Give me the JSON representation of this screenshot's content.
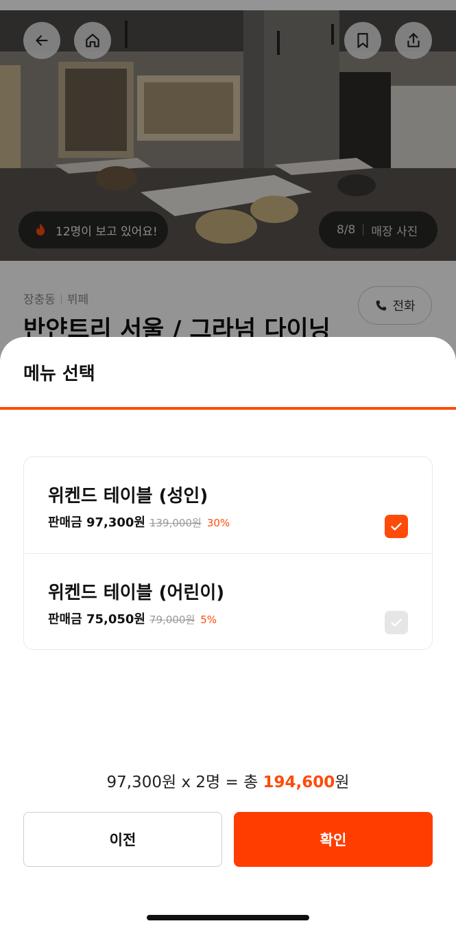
{
  "hero": {
    "viewers_text": "12명이 보고 있어요!",
    "photo_counter": "8/8",
    "photo_label": "매장 사진",
    "icons": [
      "back-arrow-icon",
      "home-icon",
      "bookmark-icon",
      "share-icon",
      "flame-icon"
    ]
  },
  "info": {
    "area": "장충동",
    "category": "뷔페",
    "title": "반얀트리 서울 / 그라넘 다이닝",
    "call_label": "전화"
  },
  "sheet": {
    "title": "메뉴 선택",
    "accent_color": "#ff4b0a",
    "menus": [
      {
        "name": "위켄드 테이블 (성인)",
        "price": "판매금 97,300원",
        "original": "139,000원",
        "discount": "30%",
        "checked": true
      },
      {
        "name": "위켄드 테이블 (어린이)",
        "price": "판매금 75,050원",
        "original": "79,000원",
        "discount": "5%",
        "checked": false
      }
    ],
    "total_prefix": "97,300원 x 2명 = 총 ",
    "total_amount": "194,600",
    "total_suffix": "원",
    "prev_label": "이전",
    "confirm_label": "확인"
  }
}
